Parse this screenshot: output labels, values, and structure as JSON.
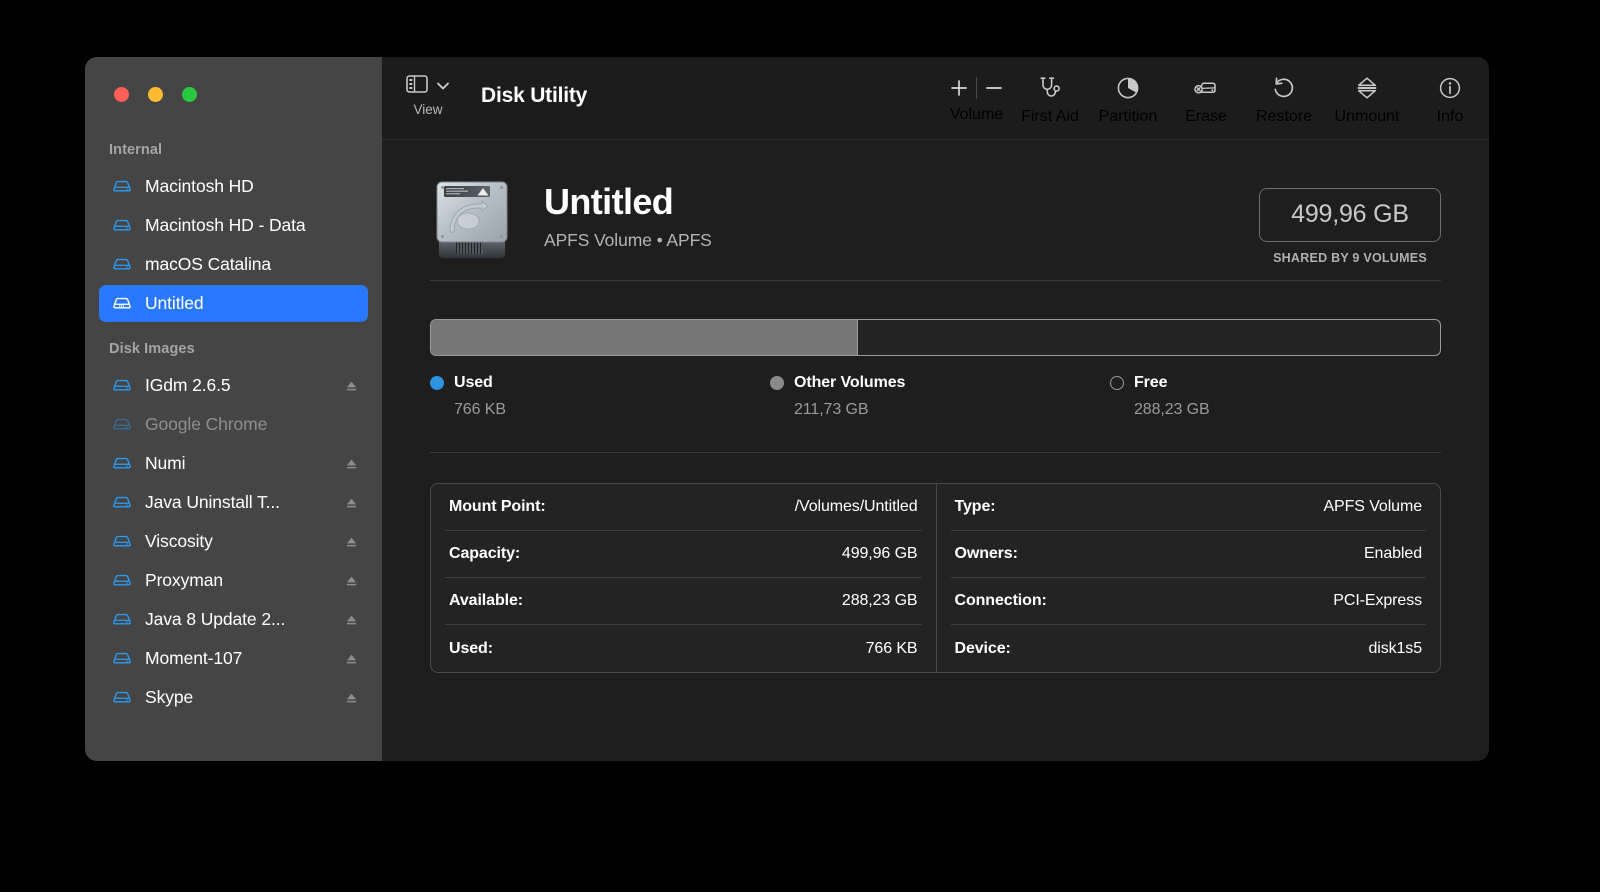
{
  "window": {
    "title": "Disk Utility",
    "traffic_lights": [
      "close",
      "minimize",
      "zoom"
    ]
  },
  "toolbar": {
    "view_label": "View",
    "volume_label": "Volume",
    "add_label": "+",
    "remove_label": "−",
    "actions": [
      {
        "name": "first-aid",
        "label": "First Aid",
        "icon": "stethoscope-icon"
      },
      {
        "name": "partition",
        "label": "Partition",
        "icon": "pie-chart-icon"
      },
      {
        "name": "erase",
        "label": "Erase",
        "icon": "erase-disk-icon"
      },
      {
        "name": "restore",
        "label": "Restore",
        "icon": "undo-arrow-icon"
      },
      {
        "name": "unmount",
        "label": "Unmount",
        "icon": "unmount-icon"
      },
      {
        "name": "info",
        "label": "Info",
        "icon": "info-circle-icon"
      }
    ]
  },
  "sidebar": {
    "groups": [
      {
        "title": "Internal",
        "items": [
          {
            "label": "Macintosh HD",
            "selected": false,
            "dim": false,
            "eject": false
          },
          {
            "label": "Macintosh HD - Data",
            "selected": false,
            "dim": false,
            "eject": false
          },
          {
            "label": "macOS Catalina",
            "selected": false,
            "dim": false,
            "eject": false
          },
          {
            "label": "Untitled",
            "selected": true,
            "dim": false,
            "eject": false
          }
        ]
      },
      {
        "title": "Disk Images",
        "items": [
          {
            "label": "IGdm 2.6.5",
            "selected": false,
            "dim": false,
            "eject": true
          },
          {
            "label": "Google Chrome",
            "selected": false,
            "dim": true,
            "eject": false
          },
          {
            "label": "Numi",
            "selected": false,
            "dim": false,
            "eject": true
          },
          {
            "label": "Java Uninstall T...",
            "selected": false,
            "dim": false,
            "eject": true
          },
          {
            "label": "Viscosity",
            "selected": false,
            "dim": false,
            "eject": true
          },
          {
            "label": "Proxyman",
            "selected": false,
            "dim": false,
            "eject": true
          },
          {
            "label": "Java 8 Update 2...",
            "selected": false,
            "dim": false,
            "eject": true
          },
          {
            "label": "Moment-107",
            "selected": false,
            "dim": false,
            "eject": true
          },
          {
            "label": "Skype",
            "selected": false,
            "dim": false,
            "eject": true
          }
        ]
      }
    ]
  },
  "volume": {
    "name": "Untitled",
    "subtitle": "APFS Volume • APFS",
    "capacity_badge": "499,96 GB",
    "shared_note": "SHARED BY 9 VOLUMES"
  },
  "chart_data": {
    "type": "bar",
    "title": "Volume capacity usage",
    "categories": [
      "Used",
      "Other Volumes",
      "Free"
    ],
    "values_text": [
      "766 KB",
      "211,73 GB",
      "288,23 GB"
    ],
    "values_gb": [
      0.00073,
      211.73,
      288.23
    ],
    "total_gb": 499.96,
    "percent": [
      0.0001,
      42.35,
      57.65
    ],
    "colors": [
      "#2b93e0",
      "#8a8a8a",
      "#00000000"
    ],
    "legend": [
      "Used",
      "Other Volumes",
      "Free"
    ],
    "legend_position": "below",
    "grid": false
  },
  "usage": {
    "other_percent": "42.35%",
    "segments": [
      {
        "label": "Used",
        "value": "766 KB",
        "swatch": "used"
      },
      {
        "label": "Other Volumes",
        "value": "211,73 GB",
        "swatch": "other"
      },
      {
        "label": "Free",
        "value": "288,23 GB",
        "swatch": "free"
      }
    ]
  },
  "info": {
    "left": [
      {
        "key": "Mount Point:",
        "value": "/Volumes/Untitled"
      },
      {
        "key": "Capacity:",
        "value": "499,96 GB"
      },
      {
        "key": "Available:",
        "value": "288,23 GB"
      },
      {
        "key": "Used:",
        "value": "766 KB"
      }
    ],
    "right": [
      {
        "key": "Type:",
        "value": "APFS Volume"
      },
      {
        "key": "Owners:",
        "value": "Enabled"
      },
      {
        "key": "Connection:",
        "value": "PCI-Express"
      },
      {
        "key": "Device:",
        "value": "disk1s5"
      }
    ]
  },
  "colors": {
    "accent": "#2879ff",
    "used": "#2b93e0",
    "other": "#8a8a8a",
    "sidebar_bg": "#454545",
    "main_bg": "#1e1e1e"
  }
}
